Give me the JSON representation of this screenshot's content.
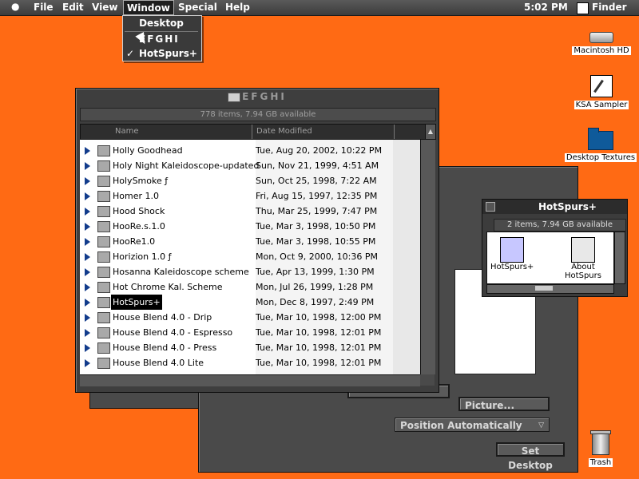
{
  "menubar": {
    "items": [
      "File",
      "Edit",
      "View",
      "Window",
      "Special",
      "Help"
    ],
    "clock": "5:02 PM",
    "app": "Finder"
  },
  "window_menu": {
    "items": [
      "Desktop",
      "EFGHI",
      "HotSpurs+"
    ],
    "checked": "HotSpurs+",
    "check_glyph": "✓"
  },
  "desktop_icons": [
    "Macintosh HD",
    "KSA Sampler",
    "Desktop Textures",
    "Trash"
  ],
  "list_window": {
    "title": "EFGHI",
    "status": "778 items, 7.94 GB available",
    "columns": [
      "Name",
      "Date Modified"
    ],
    "sort_glyph": "▲",
    "rows": [
      {
        "name": "Holly Goodhead",
        "date": "Tue, Aug 20, 2002, 10:22 PM"
      },
      {
        "name": "Holy Night Kaleidoscope-updated",
        "date": "Sun, Nov 21, 1999, 4:51 AM"
      },
      {
        "name": "HolySmoke ƒ",
        "date": "Sun, Oct 25, 1998, 7:22 AM"
      },
      {
        "name": "Homer 1.0",
        "date": "Fri, Aug 15, 1997, 12:35 PM"
      },
      {
        "name": "Hood Shock",
        "date": "Thu, Mar 25, 1999, 7:47 PM"
      },
      {
        "name": "HooRe.s.1.0",
        "date": "Tue, Mar 3, 1998, 10:50 PM"
      },
      {
        "name": "HooRe1.0",
        "date": "Tue, Mar 3, 1998, 10:55 PM"
      },
      {
        "name": "Horizion 1.0 ƒ",
        "date": "Mon, Oct 9, 2000, 10:36 PM"
      },
      {
        "name": "Hosanna Kaleidoscope scheme",
        "date": "Tue, Apr 13, 1999, 1:30 PM"
      },
      {
        "name": "Hot Chrome Kal. Scheme",
        "date": "Mon, Jul 26, 1999, 1:28 PM"
      },
      {
        "name": "HotSpurs+",
        "date": "Mon, Dec 8, 1997, 2:49 PM"
      },
      {
        "name": "House Blend 4.0 - Drip",
        "date": "Tue, Mar 10, 1998, 12:00 PM"
      },
      {
        "name": "House Blend 4.0 - Espresso",
        "date": "Tue, Mar 10, 1998, 12:01 PM"
      },
      {
        "name": "House Blend 4.0 - Press",
        "date": "Tue, Mar 10, 1998, 12:01 PM"
      },
      {
        "name": "House Blend 4.0 Lite",
        "date": "Tue, Mar 10, 1998, 12:01 PM"
      }
    ],
    "selected": "HotSpurs+"
  },
  "hotspurs_window": {
    "title": "HotSpurs+",
    "status": "2 items, 7.94 GB available",
    "items": [
      "HotSpurs+",
      "About HotSpurs"
    ]
  },
  "desktop_panel": {
    "picture_button": "Picture...",
    "position_select": "Position Automatically",
    "set_desktop_button": "Set Desktop"
  },
  "colors": {
    "desktop": "#ff6a14",
    "selection": "#000000"
  }
}
